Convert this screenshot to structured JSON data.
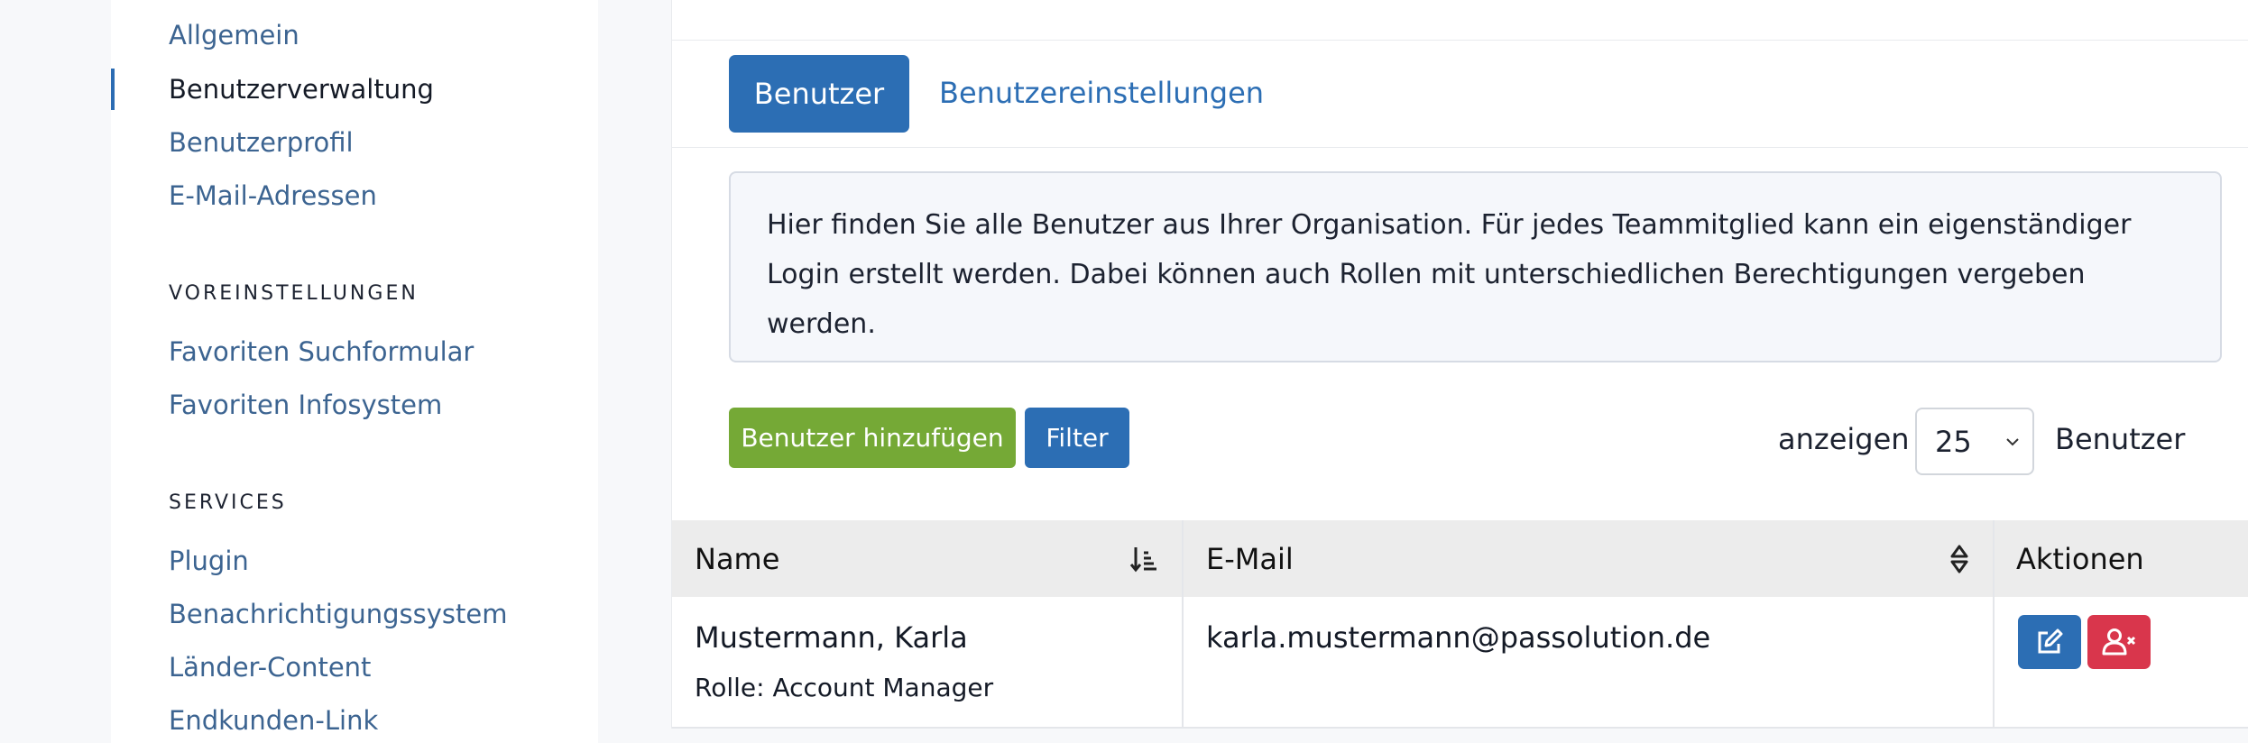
{
  "sidebar": {
    "links_top": [
      "Allgemein",
      "Benutzerverwaltung",
      "Benutzerprofil",
      "E-Mail-Adressen"
    ],
    "active": "Benutzerverwaltung",
    "section_presets": "VOREINSTELLUNGEN",
    "links_presets": [
      "Favoriten Suchformular",
      "Favoriten Infosystem"
    ],
    "section_services": "SERVICES",
    "links_services": [
      "Plugin",
      "Benachrichtigungssystem",
      "Länder-Content",
      "Endkunden-Link"
    ]
  },
  "tabs": {
    "active_label": "Benutzer",
    "other_label": "Benutzereinstellungen"
  },
  "info": {
    "text": "Hier finden Sie alle Benutzer aus Ihrer Organisation. Für jedes Teammitglied kann ein eigenständiger Login erstellt werden. Dabei können auch Rollen mit unterschiedlichen Berechtigungen vergeben werden."
  },
  "toolbar": {
    "add_label": "Benutzer hinzufügen",
    "filter_label": "Filter",
    "show_label": "anzeigen",
    "page_size": "25",
    "users_label": "Benutzer"
  },
  "table": {
    "columns": [
      "Name",
      "E-Mail",
      "Aktionen"
    ],
    "rows": [
      {
        "name": "Mustermann, Karla",
        "role": "Rolle: Account Manager",
        "email": "karla.mustermann@passolution.de"
      }
    ]
  },
  "colors": {
    "primary": "#2c6eb4",
    "success": "#75a936",
    "danger": "#d9364c"
  },
  "icons": [
    "sort-ascending-icon",
    "sort-icon",
    "edit-icon",
    "remove-user-icon",
    "chevron-down-icon"
  ]
}
